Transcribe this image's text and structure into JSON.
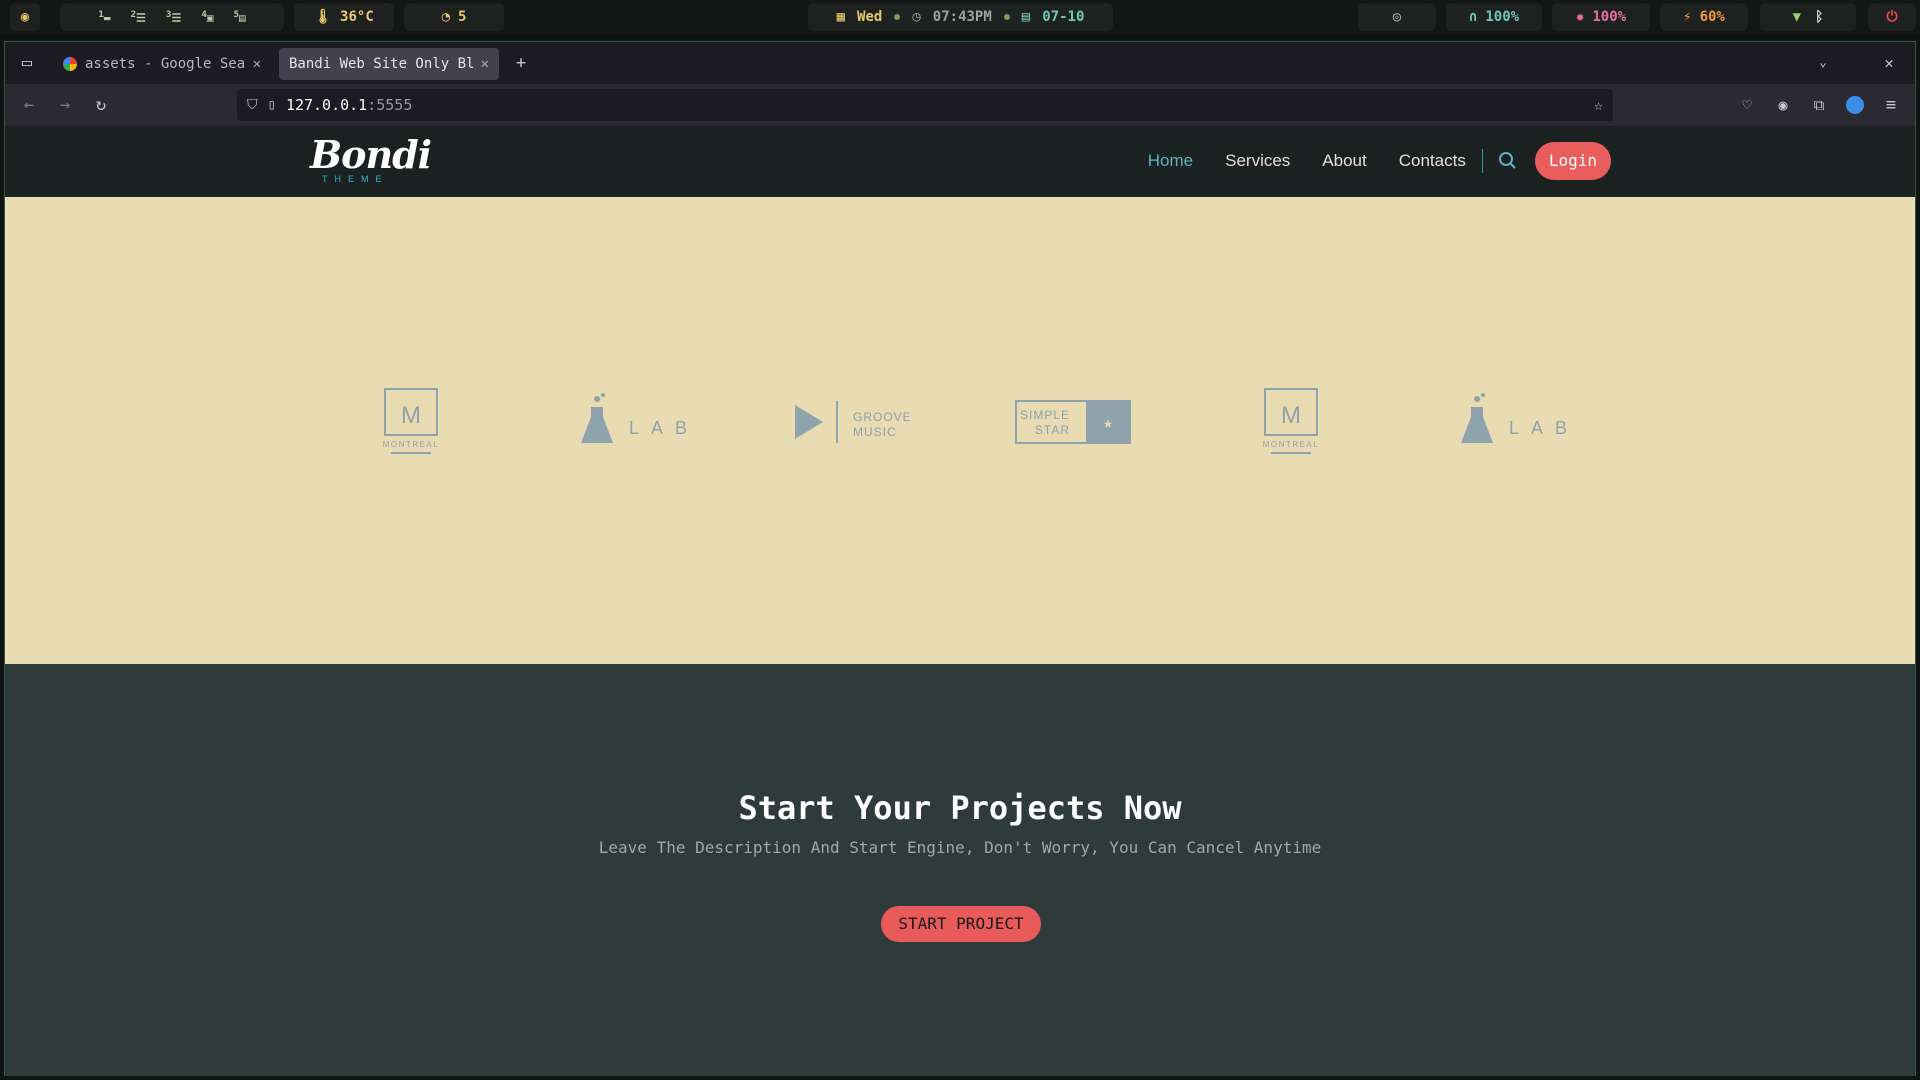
{
  "sysbar": {
    "workspaces": [
      "1",
      "2",
      "3",
      "4",
      "5"
    ],
    "temperature": "36°C",
    "updates": "5",
    "day": "Wed",
    "time": "07:43PM",
    "date": "07-10",
    "volume": "100%",
    "brightness": "100%",
    "battery": "60%"
  },
  "browser": {
    "tabs": [
      {
        "title": "assets - Google Search"
      },
      {
        "title": "Bandi Web Site Only Blank"
      }
    ],
    "url_host": "127.0.0.1",
    "url_port": ":5555"
  },
  "site": {
    "logo_script": "Bondi",
    "logo_sub": "THEME",
    "nav": [
      {
        "label": "Home",
        "active": true
      },
      {
        "label": "Services",
        "active": false
      },
      {
        "label": "About",
        "active": false
      },
      {
        "label": "Contacts",
        "active": false
      }
    ],
    "login_label": "Login",
    "brands": [
      {
        "name": "montreal",
        "mark": "M",
        "text": "MONTREAL"
      },
      {
        "name": "lab",
        "text": "LAB"
      },
      {
        "name": "groove-music",
        "line1": "GROOVE",
        "line2": "MUSIC"
      },
      {
        "name": "simple-star",
        "line1": "SIMPLE",
        "line2": "STAR"
      },
      {
        "name": "montreal",
        "mark": "M",
        "text": "MONTREAL"
      },
      {
        "name": "lab",
        "text": "LAB"
      }
    ],
    "cta": {
      "title": "Start Your Projects Now",
      "subtitle": "Leave The Description And Start Engine, Don't Worry, You Can Cancel Anytime",
      "button": "START PROJECT"
    }
  },
  "colors": {
    "header_bg": "#1b2020",
    "brands_bg": "#e9dbb2",
    "cta_bg": "#2f3b3b",
    "accent": "#ea5d5d",
    "nav_active": "#5fb4c0"
  }
}
